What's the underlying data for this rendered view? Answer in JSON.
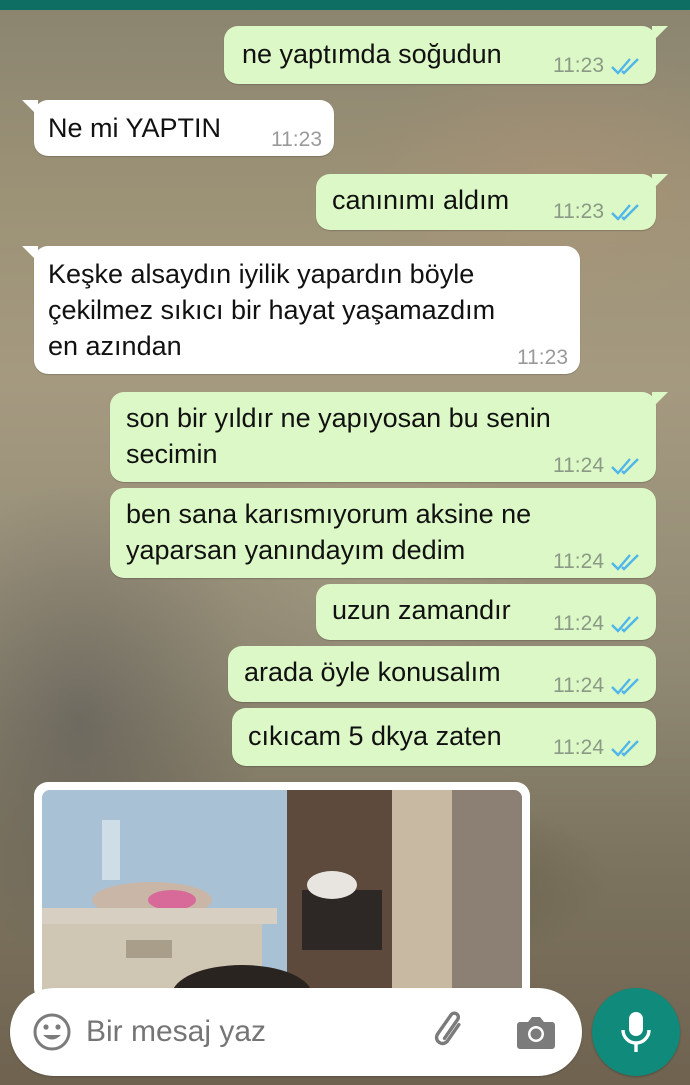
{
  "messages": [
    {
      "dir": "out",
      "text": "ne yaptımda soğudun",
      "time": "11:23",
      "status": "read"
    },
    {
      "dir": "in",
      "text": "Ne mi YAPTIN",
      "time": "11:23"
    },
    {
      "dir": "out",
      "text": "canınımı aldım",
      "time": "11:23",
      "status": "read"
    },
    {
      "dir": "in",
      "text": "Keşke alsaydın iyilik yapardın böyle\nçekilmez sıkıcı bir hayat yaşamazdım\nen azından",
      "time": "11:23"
    },
    {
      "dir": "out",
      "text": "son bir yıldır ne yapıyosan bu senin\nsecimin",
      "time": "11:24",
      "status": "read"
    },
    {
      "dir": "out",
      "text": "ben sana karısmıyorum aksine ne\nyaparsan yanındayım dedim",
      "time": "11:24",
      "status": "read"
    },
    {
      "dir": "out",
      "text": "uzun zamandır",
      "time": "11:24",
      "status": "read"
    },
    {
      "dir": "out",
      "text": "arada öyle konusalım",
      "time": "11:24",
      "status": "read"
    },
    {
      "dir": "out",
      "text": "cıkıcam 5 dkya zaten",
      "time": "11:24",
      "status": "read"
    }
  ],
  "media_message": {
    "dir": "in",
    "type": "photo"
  },
  "composer": {
    "placeholder": "Bir mesaj yaz",
    "icons": [
      "emoji-icon",
      "attach-icon",
      "camera-icon",
      "mic-icon"
    ]
  },
  "colors": {
    "outgoing_bubble": "#dcf8c6",
    "incoming_bubble": "#ffffff",
    "read_ticks": "#4fb6ec",
    "accent": "#0f8a7b",
    "header_strip": "#0e6e63"
  }
}
